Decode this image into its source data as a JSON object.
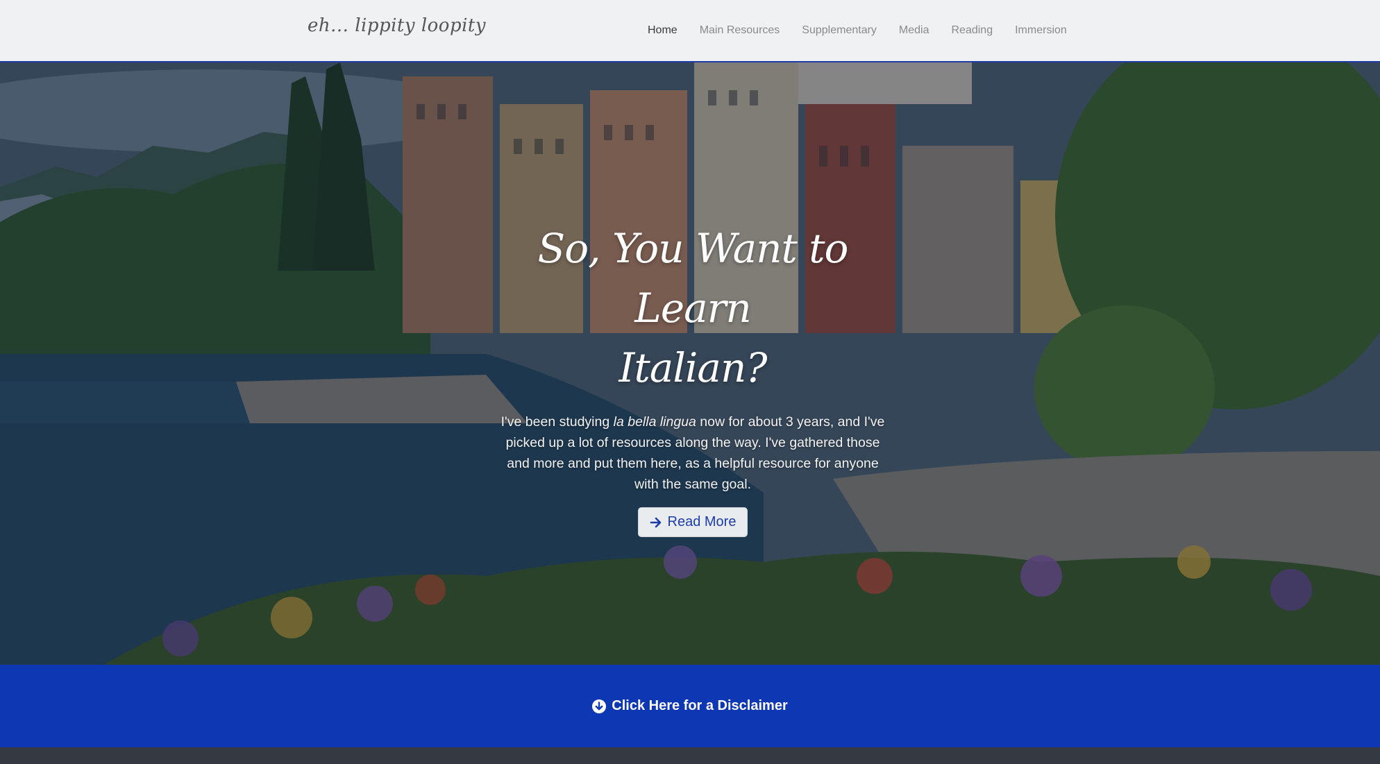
{
  "brand": "eh... lippity loopity",
  "nav": {
    "items": [
      {
        "label": "Home",
        "active": true
      },
      {
        "label": "Main Resources"
      },
      {
        "label": "Supplementary"
      },
      {
        "label": "Media"
      },
      {
        "label": "Reading"
      },
      {
        "label": "Immersion"
      }
    ]
  },
  "hero": {
    "title_line1": "So, You Want to Learn",
    "title_line2": "Italian?",
    "text_before": "I've been studying ",
    "text_italic": "la bella lingua",
    "text_after": " now for about 3 years, and I've picked up a lot of resources along the way. I've gathered those and more and put them here, as a helpful resource for anyone with the same goal.",
    "button_label": "Read More",
    "button_icon": "arrow-right-icon"
  },
  "disclaimer": {
    "label": "Click Here for a Disclaimer",
    "icon": "circle-arrow-down-icon"
  },
  "colors": {
    "accent": "#0e37b3",
    "navbar_bg": "#f8f9fa",
    "footer_bg": "#343a40"
  }
}
